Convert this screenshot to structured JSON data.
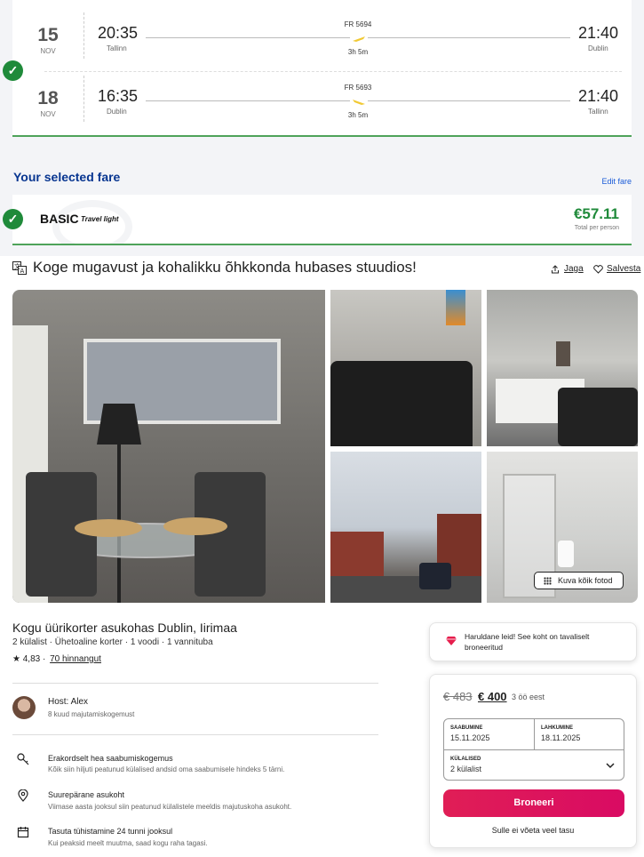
{
  "flights": [
    {
      "day": "15",
      "month": "NOV",
      "dep_time": "20:35",
      "dep_city": "Tallinn",
      "flight_no": "FR 5694",
      "duration": "3h 5m",
      "arr_time": "21:40",
      "arr_city": "Dublin"
    },
    {
      "day": "18",
      "month": "NOV",
      "dep_time": "16:35",
      "dep_city": "Dublin",
      "flight_no": "FR 5693",
      "duration": "3h 5m",
      "arr_time": "21:40",
      "arr_city": "Tallinn"
    }
  ],
  "fare": {
    "section_title": "Your selected fare",
    "edit_label": "Edit fare",
    "name": "BASIC",
    "subtitle": "Travel light",
    "price": "€57.11",
    "price_note": "Total per person"
  },
  "listing": {
    "title": "Koge mugavust ja kohalikku õhkkonda hubases stuudios!",
    "share_label": "Jaga",
    "save_label": "Salvesta",
    "show_all_label": "Kuva kõik fotod",
    "place_title": "Kogu üürikorter asukohas Dublin, Iirimaa",
    "place_sub": "2 külalist · Ühetoaline korter · 1 voodi · 1 vannituba",
    "rating": "4,83",
    "reviews": "70 hinnangut",
    "host_name": "Host: Alex",
    "host_sub": "8 kuud majutamiskogemust",
    "features": [
      {
        "icon": "key-icon",
        "title": "Erakordselt hea saabumiskogemus",
        "desc": "Kõik siin hiljuti peatunud külalised andsid oma saabumisele hindeks 5 tärni."
      },
      {
        "icon": "location-pin-icon",
        "title": "Suurepärane asukoht",
        "desc": "Viimase aasta jooksul siin peatunud külalistele meeldis majutuskoha asukoht."
      },
      {
        "icon": "calendar-icon",
        "title": "Tasuta tühistamine 24 tunni jooksul",
        "desc": "Kui peaksid meelt muutma, saad kogu raha tagasi."
      }
    ]
  },
  "booking": {
    "rare_find": "Haruldane leid! See koht on tavaliselt broneeritud",
    "old_price": "€ 483",
    "new_price": "€ 400",
    "nights": "3 öö eest",
    "checkin_label": "SAABUMINE",
    "checkin_value": "15.11.2025",
    "checkout_label": "LAHKUMINE",
    "checkout_value": "18.11.2025",
    "guests_label": "KÜLALISED",
    "guests_value": "2 külalist",
    "book_label": "Broneeri",
    "no_charge": "Sulle ei võeta veel tasu"
  },
  "colors": {
    "ryanair_blue": "#073590",
    "success_green": "#1f8a3a",
    "airbnb_pink": "#e01e56",
    "ryanair_yellow": "#f1c933"
  }
}
